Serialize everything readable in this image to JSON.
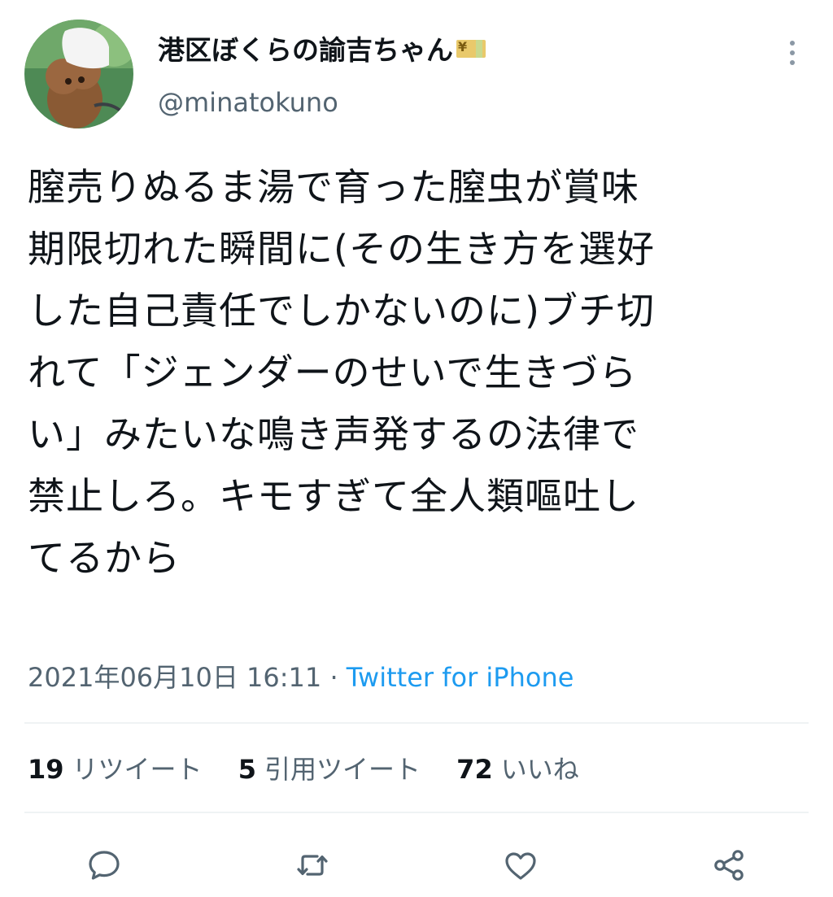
{
  "author": {
    "display_name": "港区ぼくらの諭吉ちゃん",
    "handle": "@minatokuno",
    "name_emoji": "yen-banknote-icon"
  },
  "tweet": {
    "lines": [
      "膣売りぬるま湯で育った膣虫が賞味",
      "期限切れた瞬間に(その生き方を選好",
      "した自己責任でしかないのに)ブチ切",
      "れて「ジェンダーのせいで生きづら",
      "い」みたいな鳴き声発するの法律で",
      "禁止しろ。キモすぎて全人類嘔吐し",
      "てるから"
    ],
    "timestamp": "2021年06月10日 16:11",
    "separator": " · ",
    "source": "Twitter for iPhone"
  },
  "stats": {
    "retweets_count": "19",
    "retweets_label": "リツイート",
    "quotes_count": "5",
    "quotes_label": "引用ツイート",
    "likes_count": "72",
    "likes_label": "いいね"
  },
  "actions": [
    "reply-icon",
    "retweet-icon",
    "like-icon",
    "share-icon"
  ],
  "colors": {
    "text": "#0f1419",
    "secondary": "#536471",
    "link": "#1d9bf0",
    "divider": "#eff3f4"
  }
}
